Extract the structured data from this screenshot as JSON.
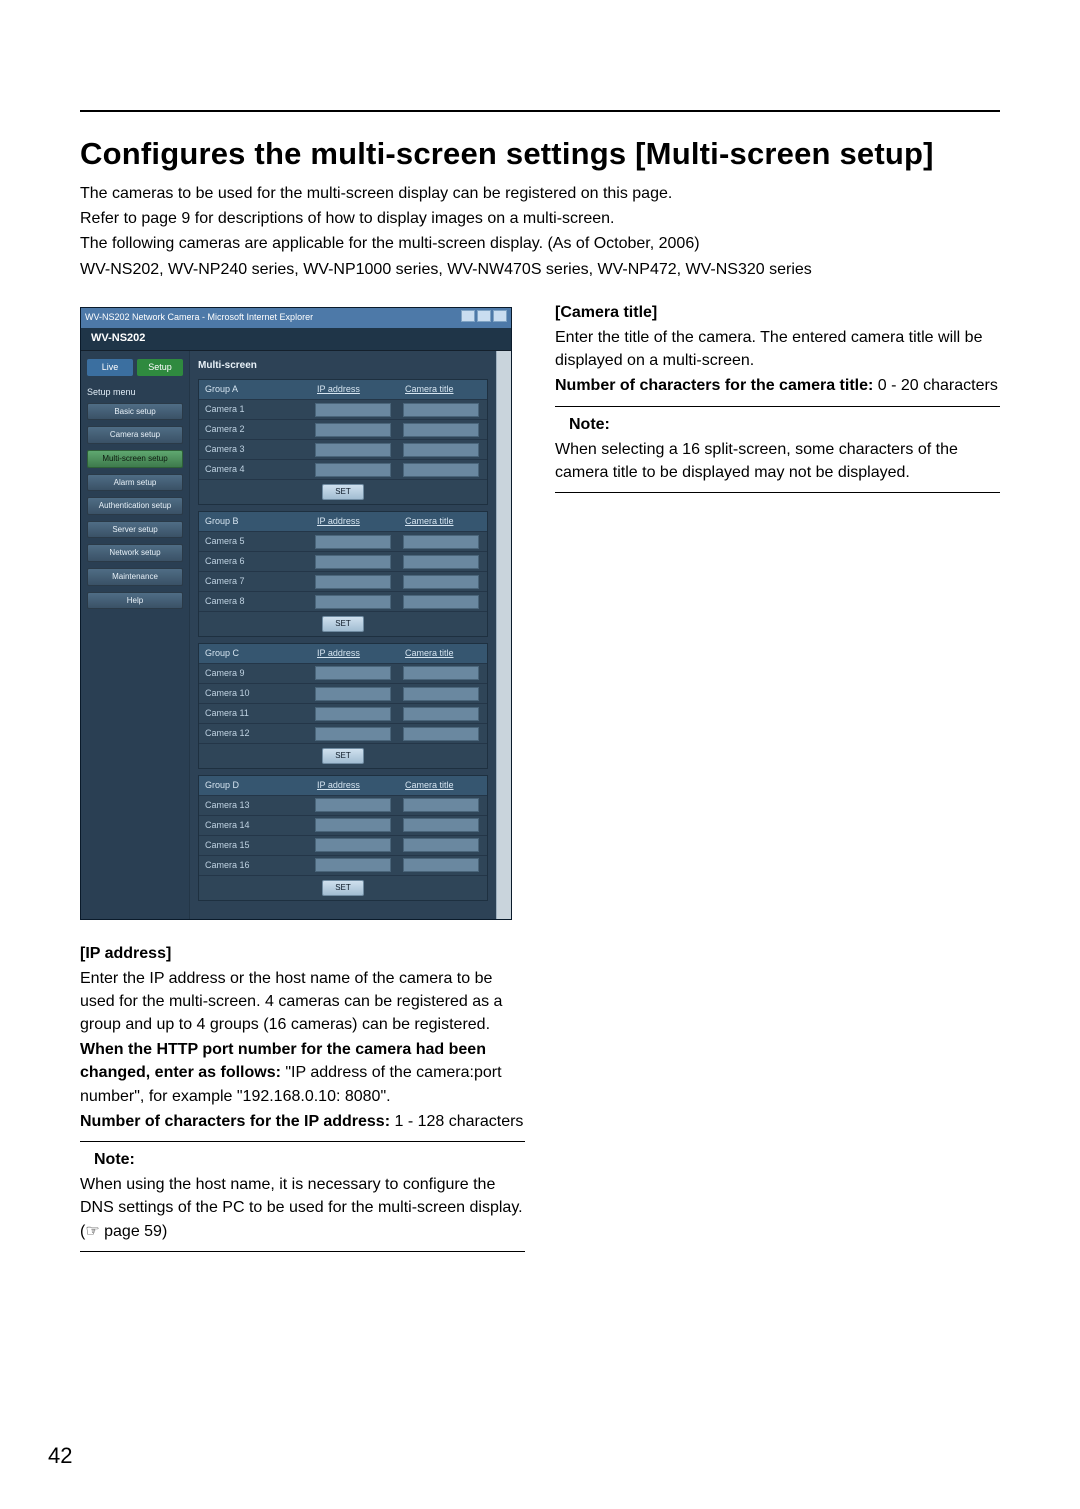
{
  "page_number": "42",
  "heading": "Configures the multi-screen settings [Multi-screen setup]",
  "intro": {
    "l1": "The cameras to be used for the multi-screen display can be registered on this page.",
    "l2": "Refer to page 9 for descriptions of how to display images on a multi-screen.",
    "l3": "The following cameras are applicable for the multi-screen display. (As of October, 2006)",
    "l4": "WV-NS202, WV-NP240 series, WV-NP1000 series, WV-NW470S series, WV-NP472, WV-NS320 series"
  },
  "left": {
    "ip_title": "[IP address]",
    "ip_p1": "Enter the IP address or the host name of the camera to be used for the multi-screen. 4 cameras can be registered as a group and up to 4 groups (16 cameras) can be registered.",
    "ip_b1a": "When the HTTP port number for the camera had been changed, enter as follows: ",
    "ip_b1b": "\"IP address of the camera:port number\", for example \"192.168.0.10: 8080\".",
    "ip_b2a": "Number of characters for the IP address: ",
    "ip_b2b": "1 - 128 characters",
    "note_label": "Note:",
    "note_text": "When using the host name, it is necessary to configure the DNS settings of the PC to be used for the multi-screen display. (☞ page 59)"
  },
  "right": {
    "ct_title": "[Camera title]",
    "ct_p1": "Enter the title of the camera. The entered camera title will be displayed on a multi-screen.",
    "ct_b1a": "Number of characters for the camera title: ",
    "ct_b1b": "0 - 20 characters",
    "note_label": "Note:",
    "note_text": "When selecting a 16 split-screen, some characters of the camera title to be displayed may not be displayed."
  },
  "mock": {
    "titlebar": "WV-NS202 Network Camera - Microsoft Internet Explorer",
    "brand": "WV-NS202",
    "tabs": {
      "live": "Live",
      "setup": "Setup"
    },
    "menu_head": "Setup menu",
    "menu": [
      "Basic setup",
      "Camera setup",
      "Multi-screen setup",
      "Alarm setup",
      "Authentication setup",
      "Server setup",
      "Network setup",
      "Maintenance",
      "Help"
    ],
    "panel_title": "Multi-screen",
    "col_ip": "IP address",
    "col_ct": "Camera title",
    "set": "SET",
    "groups": [
      {
        "name": "Group A",
        "rows": [
          "Camera 1",
          "Camera 2",
          "Camera 3",
          "Camera 4"
        ]
      },
      {
        "name": "Group B",
        "rows": [
          "Camera 5",
          "Camera 6",
          "Camera 7",
          "Camera 8"
        ]
      },
      {
        "name": "Group C",
        "rows": [
          "Camera 9",
          "Camera 10",
          "Camera 11",
          "Camera 12"
        ]
      },
      {
        "name": "Group D",
        "rows": [
          "Camera 13",
          "Camera 14",
          "Camera 15",
          "Camera 16"
        ]
      }
    ]
  }
}
